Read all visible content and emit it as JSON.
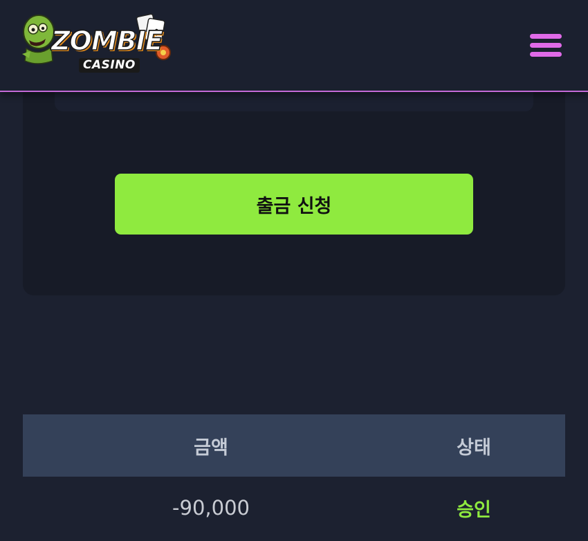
{
  "header": {
    "logo_text": "ZOMBIE",
    "logo_subtext": "CASINO",
    "menu_icon": "hamburger-menu-icon",
    "accent_color": "#e06ae8"
  },
  "withdraw": {
    "button_label": "출금 신청",
    "button_color": "#8fea3f"
  },
  "history": {
    "columns": {
      "amount": "금액",
      "status": "상태"
    },
    "rows": [
      {
        "amount": "-90,000",
        "status": "승인"
      }
    ],
    "status_color": "#8fea3f"
  }
}
